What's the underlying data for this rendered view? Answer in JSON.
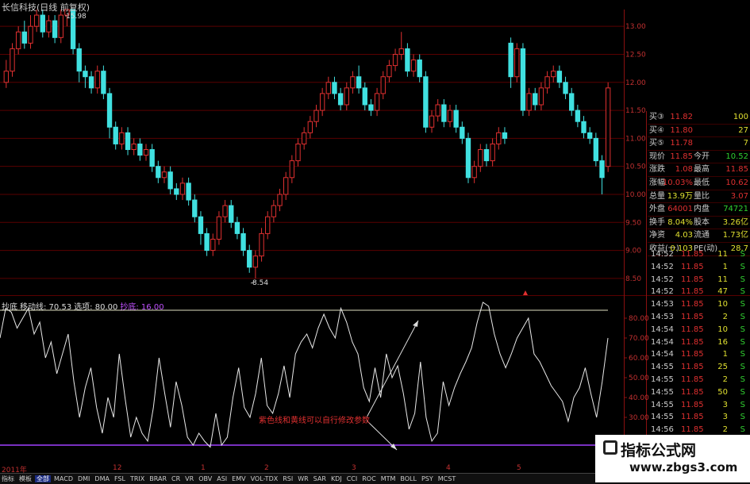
{
  "window": {
    "title": "长信科技(日线 前复权)"
  },
  "chart_data": {
    "type": "candlestick",
    "price_axis": [
      "13.00",
      "12.50",
      "12.00",
      "11.50",
      "11.00",
      "10.50",
      "10.00",
      "9.50",
      "9.00",
      "8.50"
    ],
    "price_range": [
      8.3,
      13.3
    ],
    "high_label": "15.98",
    "low_label": "8.54",
    "candles": [
      [
        12.0,
        12.2,
        11.9,
        12.4
      ],
      [
        12.2,
        12.6,
        12.1,
        12.7
      ],
      [
        12.6,
        12.9,
        12.5,
        13.0
      ],
      [
        12.9,
        12.7,
        12.6,
        13.1
      ],
      [
        12.7,
        13.0,
        12.6,
        13.2
      ],
      [
        13.0,
        13.2,
        12.9,
        13.3
      ],
      [
        13.2,
        12.9,
        12.8,
        13.3
      ],
      [
        12.9,
        13.1,
        12.8,
        13.2
      ],
      [
        13.1,
        12.8,
        12.7,
        13.2
      ],
      [
        12.8,
        13.2,
        12.7,
        13.3
      ],
      [
        13.2,
        13.3,
        13.0,
        13.3
      ],
      [
        13.3,
        12.6,
        12.5,
        13.3
      ],
      [
        12.6,
        12.2,
        12.0,
        12.7
      ],
      [
        12.2,
        12.1,
        11.9,
        12.3
      ],
      [
        12.1,
        11.9,
        11.8,
        12.2
      ],
      [
        11.9,
        12.2,
        11.8,
        12.3
      ],
      [
        12.2,
        11.8,
        11.7,
        12.3
      ],
      [
        11.8,
        11.2,
        11.0,
        11.9
      ],
      [
        11.2,
        10.9,
        10.8,
        11.3
      ],
      [
        10.9,
        11.1,
        10.8,
        11.2
      ],
      [
        11.1,
        10.8,
        10.7,
        11.2
      ],
      [
        10.8,
        10.9,
        10.7,
        11.0
      ],
      [
        10.9,
        10.7,
        10.6,
        11.0
      ],
      [
        10.7,
        10.8,
        10.6,
        10.9
      ],
      [
        10.8,
        10.5,
        10.4,
        10.9
      ],
      [
        10.5,
        10.3,
        10.2,
        10.6
      ],
      [
        10.3,
        10.4,
        10.2,
        10.5
      ],
      [
        10.4,
        10.1,
        10.0,
        10.5
      ],
      [
        10.1,
        10.0,
        9.9,
        10.2
      ],
      [
        10.0,
        10.2,
        9.9,
        10.3
      ],
      [
        10.2,
        9.9,
        9.8,
        10.3
      ],
      [
        9.9,
        9.6,
        9.5,
        10.0
      ],
      [
        9.6,
        9.3,
        9.1,
        9.7
      ],
      [
        9.3,
        9.0,
        8.9,
        9.4
      ],
      [
        9.0,
        9.2,
        8.9,
        9.3
      ],
      [
        9.2,
        9.6,
        9.1,
        9.7
      ],
      [
        9.6,
        9.8,
        9.5,
        9.9
      ],
      [
        9.8,
        9.5,
        9.4,
        9.9
      ],
      [
        9.5,
        9.3,
        9.2,
        9.6
      ],
      [
        9.3,
        9.0,
        8.9,
        9.4
      ],
      [
        9.0,
        8.7,
        8.6,
        9.1
      ],
      [
        8.7,
        8.9,
        8.5,
        9.0
      ],
      [
        8.9,
        9.3,
        8.8,
        9.4
      ],
      [
        9.3,
        9.6,
        9.2,
        9.7
      ],
      [
        9.6,
        9.8,
        9.5,
        9.9
      ],
      [
        9.8,
        10.0,
        9.7,
        10.1
      ],
      [
        10.0,
        10.3,
        9.9,
        10.4
      ],
      [
        10.3,
        10.6,
        10.2,
        10.7
      ],
      [
        10.6,
        10.9,
        10.5,
        11.0
      ],
      [
        10.9,
        11.1,
        10.8,
        11.2
      ],
      [
        11.1,
        11.3,
        11.0,
        11.4
      ],
      [
        11.3,
        11.5,
        11.2,
        11.6
      ],
      [
        11.5,
        11.8,
        11.4,
        11.9
      ],
      [
        11.8,
        12.0,
        11.7,
        12.1
      ],
      [
        12.0,
        11.8,
        11.7,
        12.1
      ],
      [
        11.8,
        11.6,
        11.5,
        11.9
      ],
      [
        11.6,
        11.9,
        11.5,
        12.0
      ],
      [
        11.9,
        12.1,
        11.8,
        12.2
      ],
      [
        12.1,
        11.9,
        11.8,
        12.3
      ],
      [
        11.9,
        11.6,
        11.5,
        12.0
      ],
      [
        11.6,
        11.5,
        11.4,
        11.7
      ],
      [
        11.5,
        11.8,
        11.4,
        11.9
      ],
      [
        11.8,
        12.1,
        11.7,
        12.2
      ],
      [
        12.1,
        12.3,
        12.0,
        12.4
      ],
      [
        12.3,
        12.5,
        12.2,
        12.6
      ],
      [
        12.5,
        12.6,
        12.4,
        12.9
      ],
      [
        12.6,
        12.2,
        12.1,
        12.7
      ],
      [
        12.2,
        12.4,
        12.1,
        12.5
      ],
      [
        12.4,
        12.1,
        12.0,
        12.5
      ],
      [
        12.1,
        11.2,
        11.1,
        12.2
      ],
      [
        11.2,
        11.4,
        11.1,
        11.5
      ],
      [
        11.4,
        11.6,
        11.3,
        11.7
      ],
      [
        11.6,
        11.3,
        11.2,
        11.7
      ],
      [
        11.3,
        11.5,
        11.2,
        11.6
      ],
      [
        11.5,
        11.2,
        11.1,
        11.6
      ],
      [
        11.2,
        11.0,
        10.9,
        11.3
      ],
      [
        11.0,
        10.3,
        10.2,
        11.1
      ],
      [
        10.3,
        10.5,
        10.2,
        10.6
      ],
      [
        10.5,
        10.8,
        10.4,
        10.9
      ],
      [
        10.8,
        10.6,
        10.5,
        10.9
      ],
      [
        10.6,
        10.9,
        10.5,
        11.0
      ],
      [
        10.9,
        11.1,
        10.8,
        11.2
      ],
      [
        11.1,
        11.0,
        10.9,
        11.2
      ],
      [
        12.7,
        12.1,
        11.9,
        12.8
      ],
      [
        12.1,
        12.6,
        12.0,
        12.7
      ],
      [
        12.6,
        11.5,
        11.4,
        12.7
      ],
      [
        11.5,
        11.8,
        11.4,
        11.9
      ],
      [
        11.8,
        11.6,
        11.5,
        11.9
      ],
      [
        11.6,
        11.9,
        11.5,
        12.0
      ],
      [
        11.9,
        12.1,
        11.8,
        12.2
      ],
      [
        12.1,
        12.2,
        12.0,
        12.3
      ],
      [
        12.2,
        12.0,
        11.9,
        12.3
      ],
      [
        12.0,
        11.8,
        11.7,
        12.1
      ],
      [
        11.8,
        11.5,
        11.4,
        11.9
      ],
      [
        11.5,
        11.3,
        11.2,
        11.6
      ],
      [
        11.3,
        11.1,
        11.0,
        11.4
      ],
      [
        11.1,
        11.0,
        10.9,
        11.2
      ],
      [
        11.0,
        10.6,
        10.5,
        11.1
      ],
      [
        10.6,
        10.3,
        10.0,
        10.7
      ],
      [
        10.5,
        11.9,
        10.4,
        12.0
      ]
    ],
    "indicator": {
      "name": "抄底",
      "params": [
        {
          "label": "抄底",
          "color": "#ddd"
        },
        {
          "label": "移动线: 70.53",
          "color": "#ddd"
        },
        {
          "label": "选项: 80.00",
          "color": "#ddd"
        },
        {
          "label": "抄底: 16.00",
          "color": "#c050ff"
        }
      ],
      "yaxis": [
        "80.00",
        "70.00",
        "60.00",
        "50.00",
        "40.00",
        "30.00"
      ],
      "range": [
        10,
        90
      ],
      "upper_line": 84,
      "lower_line": 16,
      "values": [
        70,
        85,
        83,
        75,
        80,
        85,
        72,
        78,
        60,
        68,
        52,
        62,
        72,
        48,
        30,
        45,
        55,
        35,
        22,
        40,
        30,
        62,
        40,
        20,
        30,
        22,
        18,
        35,
        60,
        42,
        25,
        48,
        36,
        20,
        16,
        22,
        18,
        15,
        32,
        16,
        20,
        40,
        55,
        35,
        30,
        42,
        60,
        36,
        32,
        42,
        56,
        40,
        62,
        68,
        72,
        65,
        75,
        82,
        75,
        70,
        85,
        78,
        68,
        62,
        45,
        38,
        55,
        40,
        62,
        50,
        56,
        42,
        24,
        32,
        58,
        30,
        18,
        22,
        48,
        36,
        45,
        52,
        58,
        65,
        78,
        88,
        86,
        72,
        62,
        55,
        62,
        70,
        75,
        80,
        62,
        58,
        52,
        46,
        42,
        38,
        28,
        40,
        45,
        55,
        42,
        30,
        48,
        70
      ]
    },
    "x_labels": [
      "2011年",
      "12",
      "1",
      "2",
      "3",
      "4",
      "5"
    ]
  },
  "annotation": "紫色线和黄线可以自行修改参数",
  "quote": {
    "rows": [
      {
        "l1": "买③",
        "v1": "11.82",
        "c1": "#e03030",
        "l2": "",
        "v2": "100",
        "c2": "#e0e030"
      },
      {
        "l1": "买④",
        "v1": "11.80",
        "c1": "#e03030",
        "l2": "",
        "v2": "27",
        "c2": "#e0e030"
      },
      {
        "l1": "买⑤",
        "v1": "11.78",
        "c1": "#e03030",
        "l2": "",
        "v2": "7",
        "c2": "#e0e030"
      },
      {
        "l1": "现价",
        "v1": "11.85",
        "c1": "#e03030",
        "l2": "今开",
        "v2": "10.52",
        "c2": "#30d030"
      },
      {
        "l1": "涨跌",
        "v1": "1.08",
        "c1": "#e03030",
        "l2": "最高",
        "v2": "11.85",
        "c2": "#e03030"
      },
      {
        "l1": "涨幅",
        "v1": "10.03%",
        "c1": "#e03030",
        "l2": "最低",
        "v2": "10.62",
        "c2": "#e03030"
      },
      {
        "l1": "总量",
        "v1": "13.9万",
        "c1": "#e0e030",
        "l2": "量比",
        "v2": "3.07",
        "c2": "#e03030"
      },
      {
        "l1": "外盘",
        "v1": "64001",
        "c1": "#e03030",
        "l2": "内盘",
        "v2": "74721",
        "c2": "#30d030"
      },
      {
        "l1": "换手",
        "v1": "8.04%",
        "c1": "#e0e030",
        "l2": "股本",
        "v2": "3.26亿",
        "c2": "#e0e030"
      },
      {
        "l1": "净资",
        "v1": "4.03",
        "c1": "#e0e030",
        "l2": "流通",
        "v2": "1.73亿",
        "c2": "#e0e030"
      },
      {
        "l1": "收益(一)",
        "v1": "0.103",
        "c1": "#e0e030",
        "l2": "PE(动)",
        "v2": "28.7",
        "c2": "#e0e030"
      }
    ]
  },
  "trades": [
    {
      "t": "14:52",
      "p": "11.85",
      "v": "11",
      "s": "S"
    },
    {
      "t": "14:52",
      "p": "11.85",
      "v": "1",
      "s": "S"
    },
    {
      "t": "14:52",
      "p": "11.85",
      "v": "11",
      "s": "S"
    },
    {
      "t": "14:52",
      "p": "11.85",
      "v": "47",
      "s": "S"
    },
    {
      "t": "14:53",
      "p": "11.85",
      "v": "10",
      "s": "S"
    },
    {
      "t": "14:53",
      "p": "11.85",
      "v": "2",
      "s": "S"
    },
    {
      "t": "14:54",
      "p": "11.85",
      "v": "10",
      "s": "S"
    },
    {
      "t": "14:54",
      "p": "11.85",
      "v": "16",
      "s": "S"
    },
    {
      "t": "14:54",
      "p": "11.85",
      "v": "1",
      "s": "S"
    },
    {
      "t": "14:55",
      "p": "11.85",
      "v": "25",
      "s": "S"
    },
    {
      "t": "14:55",
      "p": "11.85",
      "v": "2",
      "s": "S"
    },
    {
      "t": "14:55",
      "p": "11.85",
      "v": "50",
      "s": "S"
    },
    {
      "t": "14:55",
      "p": "11.85",
      "v": "3",
      "s": "S"
    },
    {
      "t": "14:55",
      "p": "11.85",
      "v": "3",
      "s": "S"
    },
    {
      "t": "14:56",
      "p": "11.85",
      "v": "2",
      "s": "S"
    },
    {
      "t": "14:56",
      "p": "11.85",
      "v": "3",
      "s": "S"
    }
  ],
  "tabs": [
    "指标",
    "模板",
    "全部",
    "MACD",
    "DMI",
    "DMA",
    "FSL",
    "TRIX",
    "BRAR",
    "CR",
    "VR",
    "OBV",
    "ASI",
    "EMV",
    "VOL-TDX",
    "RSI",
    "WR",
    "SAR",
    "KDJ",
    "CCI",
    "ROC",
    "MTM",
    "BOLL",
    "PSY",
    "MCST"
  ],
  "watermark": {
    "title": "指标公式网",
    "url": "www.zbgs3.com"
  },
  "colors": {
    "up": "#e03030",
    "down": "#40e0e0",
    "grid": "#5a0000",
    "bg": "#000000",
    "indicator_line": "#e8e8e8",
    "upper_line": "#e0e0c0",
    "lower_line": "#a040ff"
  }
}
